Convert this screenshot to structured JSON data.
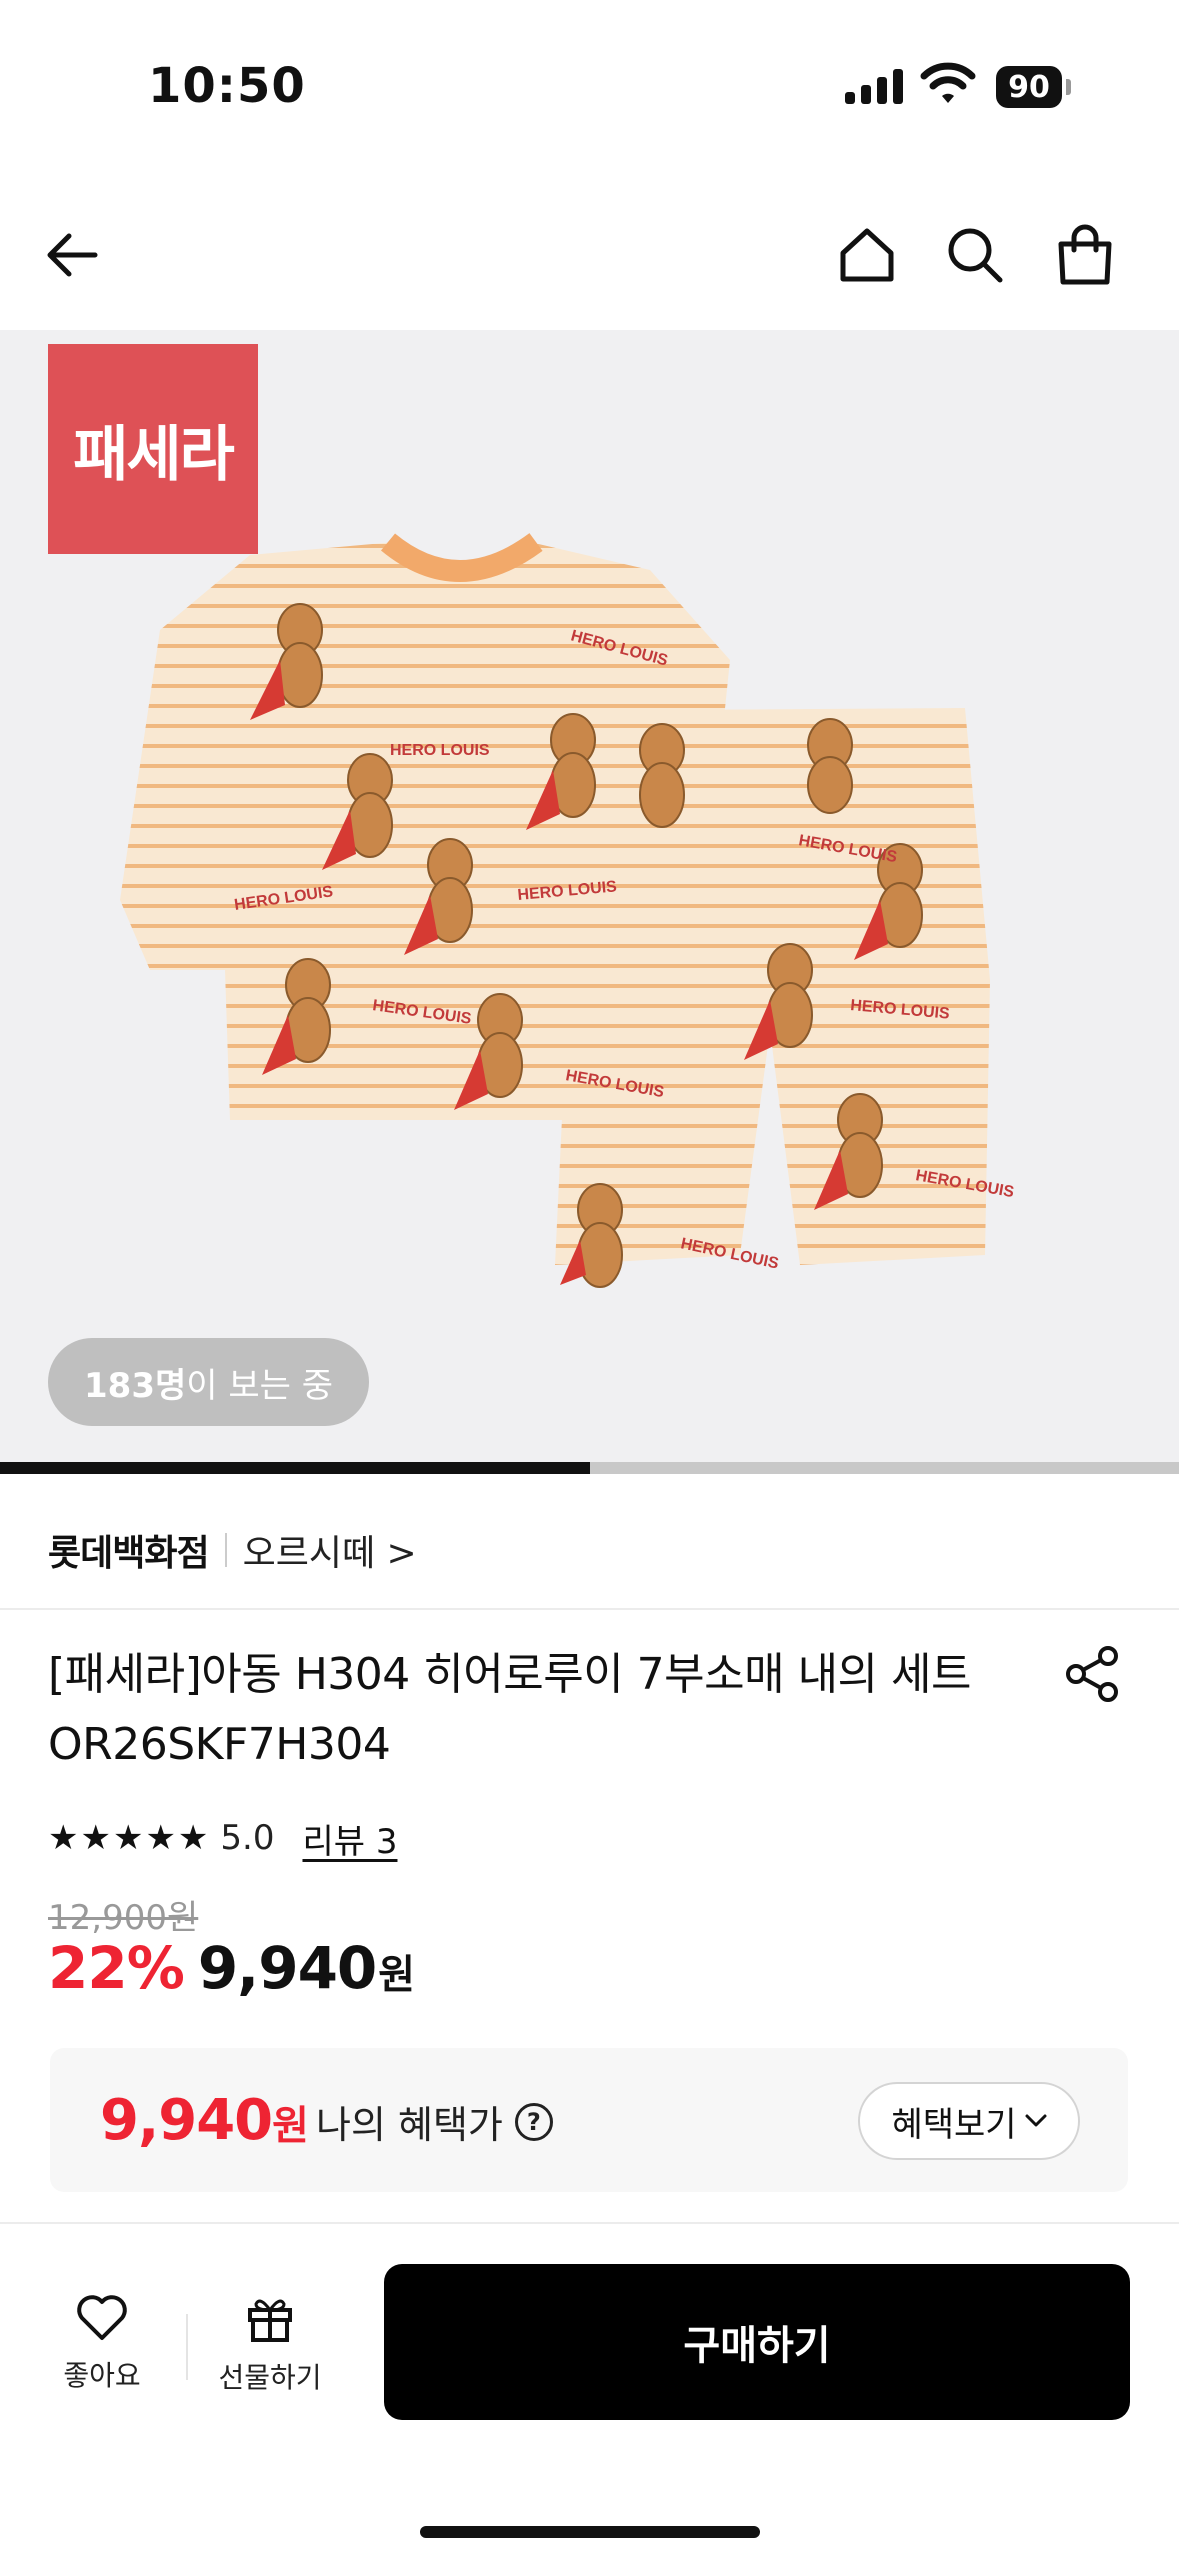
{
  "status_bar": {
    "time": "10:50",
    "battery": "90"
  },
  "brand_logo_text": "패세라",
  "viewers": {
    "count": "183명",
    "suffix": "이 보는 중"
  },
  "image_carousel": {
    "progress": 0.5
  },
  "store": {
    "name": "롯데백화점",
    "brand": "오르시떼 >"
  },
  "product": {
    "title": "[패세라]아동 H304 히어로루이 7부소매 내의 세트 OR26SKF7H304",
    "stars": "★★★★★",
    "rating": "5.0",
    "reviews": "리뷰 3",
    "original_price": "12,900원",
    "discount": "22%",
    "sale_price": "9,940",
    "currency": "원"
  },
  "benefit": {
    "price": "9,940",
    "currency": "원",
    "label": "나의 혜택가",
    "help": "?",
    "button": "혜택보기"
  },
  "bottom_bar": {
    "like": "좋아요",
    "gift": "선물하기",
    "buy": "구매하기"
  },
  "colors": {
    "accent": "#ee2433",
    "brand_logo": "#de5156",
    "buy_button": "#000000"
  }
}
